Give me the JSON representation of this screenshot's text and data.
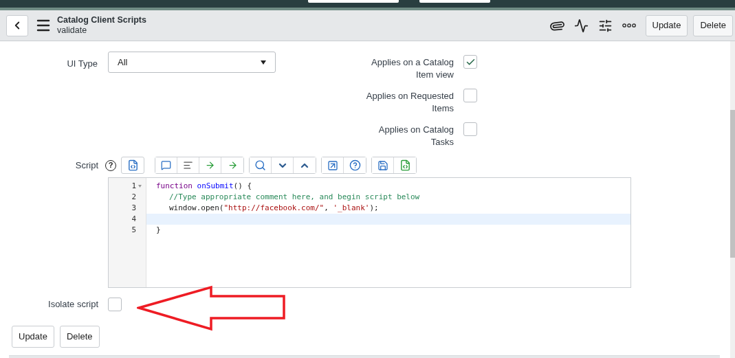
{
  "header": {
    "title": "Catalog Client Scripts",
    "subtitle": "validate",
    "buttons": [
      "Update",
      "Delete"
    ]
  },
  "ui_type": {
    "label": "UI Type",
    "value": "All"
  },
  "applies": [
    {
      "label": "Applies on a Catalog Item view",
      "checked": true
    },
    {
      "label": "Applies on Requested Items",
      "checked": false
    },
    {
      "label": "Applies on Catalog Tasks",
      "checked": false
    }
  ],
  "script": {
    "label": "Script",
    "help": "?",
    "lines": [
      {
        "number": "1",
        "fold": true,
        "selected": false,
        "tokens": [
          {
            "kind": "keyword",
            "text": "function"
          },
          {
            "kind": "name",
            "text": "onSubmit"
          },
          {
            "kind": "plain",
            "text": "() {"
          }
        ],
        "children": [
          {
            "number": "2",
            "fold": false,
            "selected": false,
            "tokens": [
              {
                "kind": "comment",
                "text": "//Type appropriate comment here, and begin script below"
              }
            ]
          },
          {
            "number": "3",
            "fold": false,
            "selected": false,
            "tokens": [
              {
                "kind": "plain",
                "text": "window.open("
              },
              {
                "kind": "string",
                "text": "\"http://facebook.com/\""
              },
              {
                "kind": "plain",
                "text": ", "
              },
              {
                "kind": "string",
                "text": "'_blank'"
              },
              {
                "kind": "plain",
                "text": ");"
              }
            ]
          },
          {
            "number": "4",
            "fold": false,
            "selected": true
          }
        ]
      },
      {
        "number": "5",
        "fold": false,
        "selected": false,
        "tokens": [
          {
            "kind": "plain",
            "text": "}"
          }
        ]
      }
    ]
  },
  "isolate": {
    "label": "Isolate script",
    "checked": false
  },
  "buttons": [
    "Update",
    "Delete"
  ]
}
